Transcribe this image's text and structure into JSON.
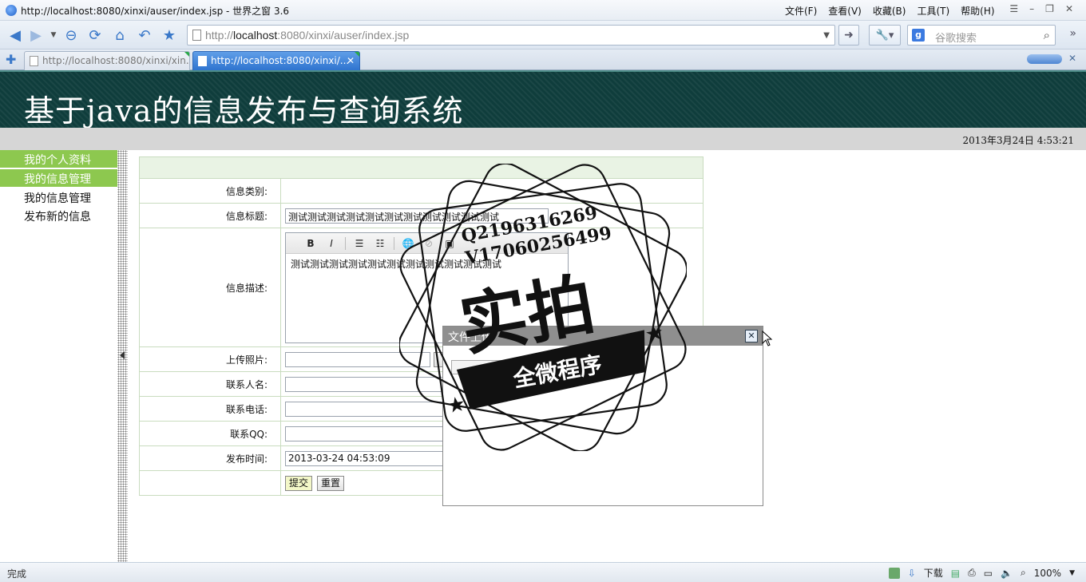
{
  "window": {
    "title": "http://localhost:8080/xinxi/auser/index.jsp - 世界之窗 3.6",
    "menu": [
      "文件(F)",
      "查看(V)",
      "收藏(B)",
      "工具(T)",
      "帮助(H)"
    ]
  },
  "toolbar": {
    "url_host": "localhost",
    "url_prefix": "http://",
    "url_suffix": ":8080/xinxi/auser/index.jsp",
    "search_placeholder": "谷歌搜索"
  },
  "tabs": [
    {
      "label": "http://localhost:8080/xinxi/xin...",
      "active": false
    },
    {
      "label": "http://localhost:8080/xinxi/...",
      "active": true
    }
  ],
  "page": {
    "site_title": "基于java的信息发布与查询系统",
    "datetime": "2013年3月24日  4:53:21"
  },
  "sidebar": {
    "headers": [
      "我的个人资料",
      "我的信息管理"
    ],
    "items": [
      "我的信息管理",
      "发布新的信息"
    ]
  },
  "form": {
    "category_label": "信息类别:",
    "title_label": "信息标题:",
    "title_value": "测试测试测试测试测试测试测试测试测试测试测试",
    "desc_label": "信息描述:",
    "desc_value": "测试测试测试测试测试测试测试测试测试测试测试",
    "editor_tools": [
      "B",
      "I"
    ],
    "photo_label": "上传照片:",
    "contact_label": "联系人名:",
    "phone_label": "联系电话:",
    "qq_label": "联系QQ:",
    "time_label": "发布时间:",
    "time_value": "2013-03-24 04:53:09",
    "submit_label": "提交",
    "reset_label": "重置"
  },
  "dialog": {
    "title": "文件上传"
  },
  "watermark": {
    "contact": "Q2196316269",
    "contact2": "V17060256499",
    "main": "实拍",
    "ribbon": "全微程序"
  },
  "status": {
    "text": "完成",
    "download_label": "下载",
    "zoom": "100%"
  }
}
